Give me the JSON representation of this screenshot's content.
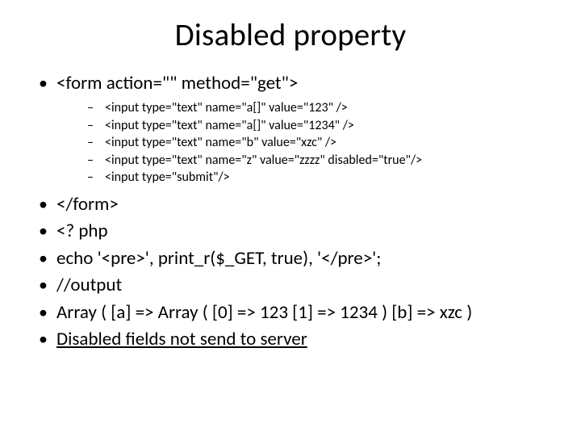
{
  "title": "Disabled property",
  "bullets": {
    "form_open": "<form action=\"\" method=\"get\">",
    "inputs": [
      "<input type=\"text\" name=\"a[]\" value=\"123\" />",
      "<input type=\"text\" name=\"a[]\" value=\"1234\" />",
      "<input type=\"text\" name=\"b\" value=\"xzc\" />",
      "<input type=\"text\" name=\"z\" value=\"zzzz\" disabled=\"true\"/>",
      "<input type=\"submit\"/>"
    ],
    "form_close": " </form>",
    "php_open": " <? php",
    "echo_line": " echo '<pre>', print_r($_GET, true), '</pre>';",
    "output_label": "//output",
    "output_value": "Array ( [a] => Array ( [0] => 123 [1] => 1234 ) [b] => xzc )",
    "summary": "Disabled fields not send to server"
  }
}
